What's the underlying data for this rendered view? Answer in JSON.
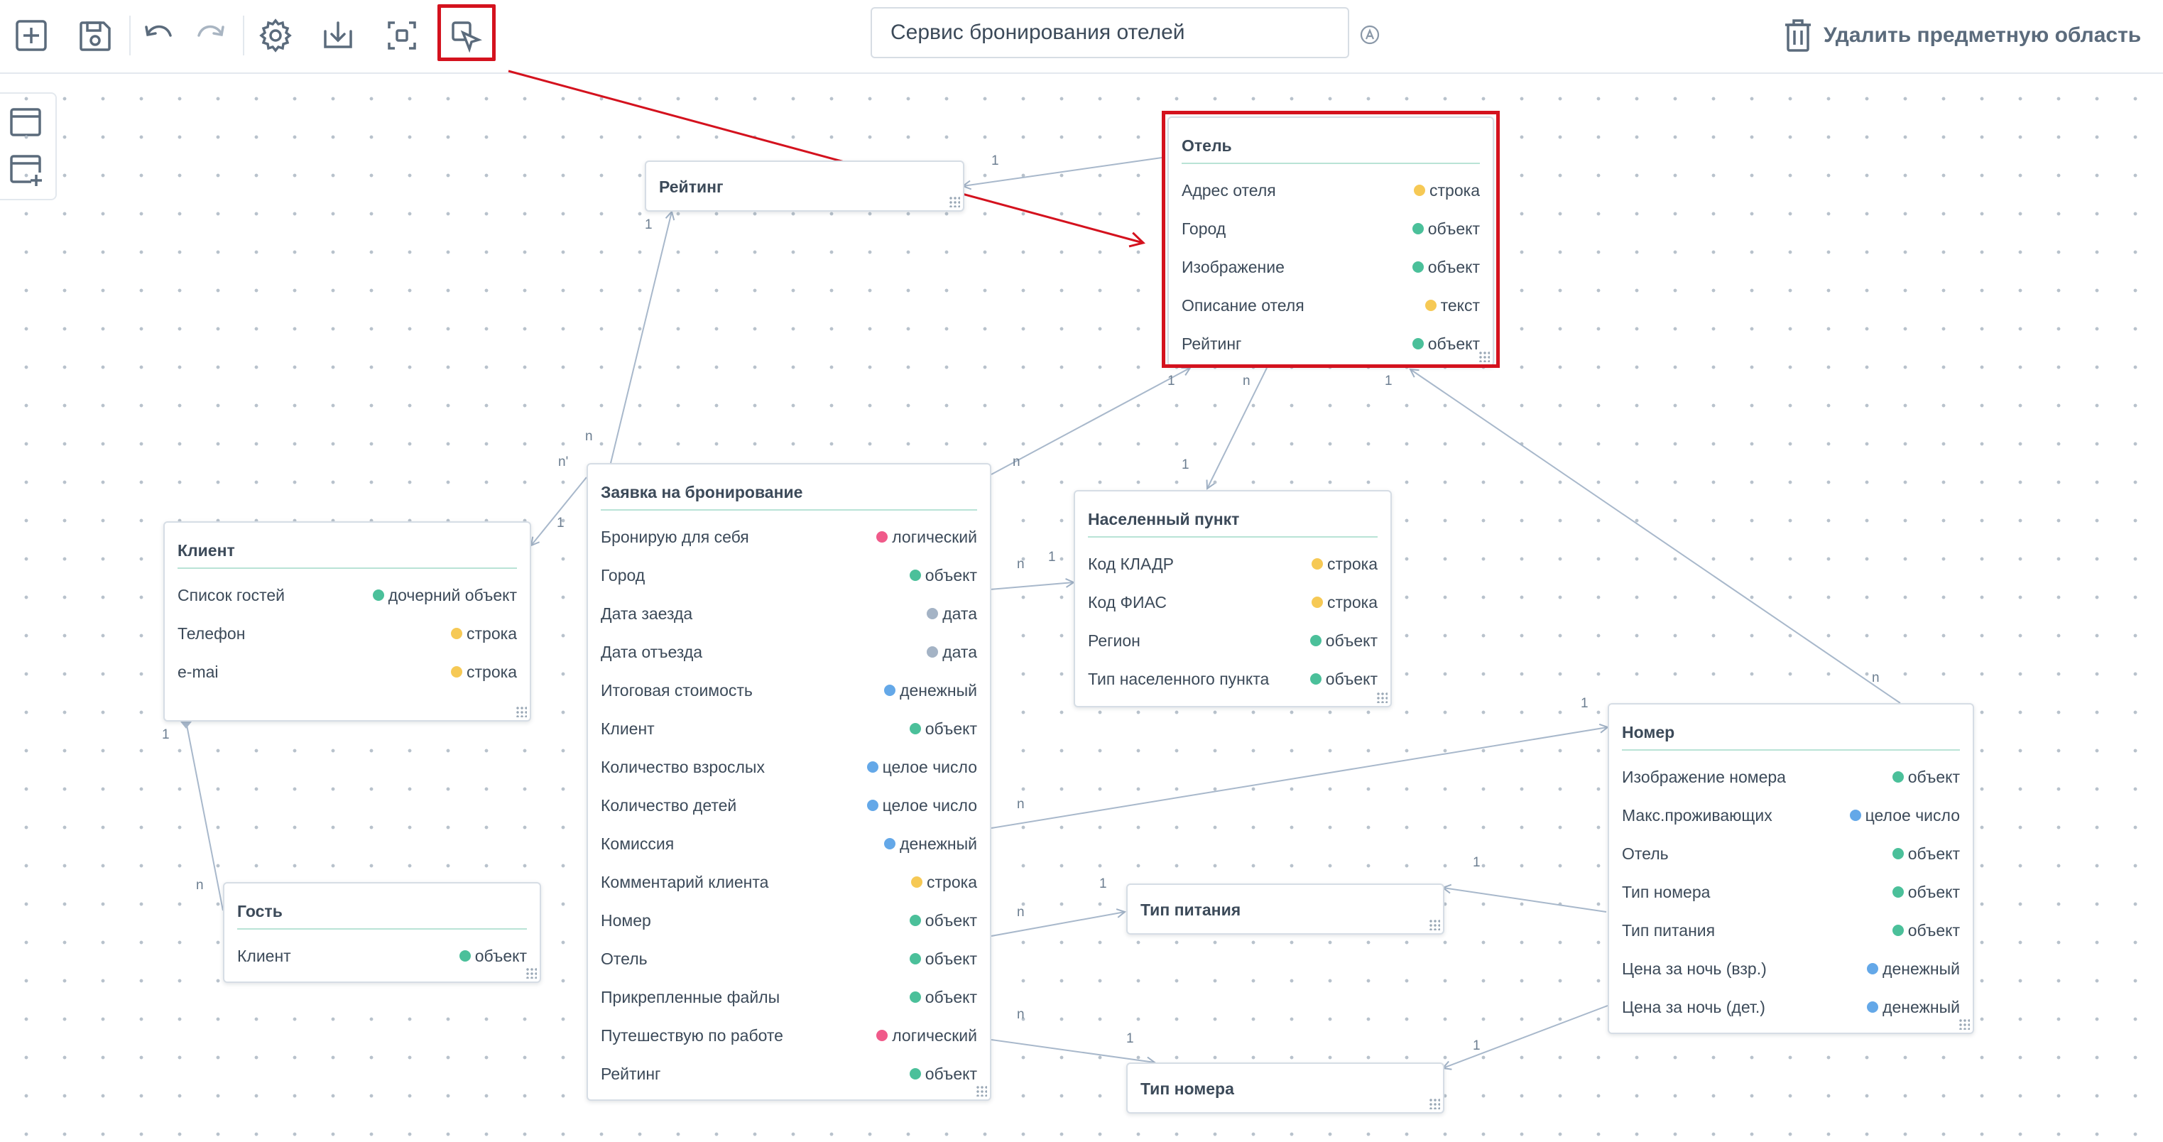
{
  "toolbar": {
    "buttons": [
      {
        "name": "add-button",
        "icon": "plus-square-icon"
      },
      {
        "name": "save-button",
        "icon": "floppy-disk-icon"
      },
      {
        "name": "undo-button",
        "icon": "undo-icon"
      },
      {
        "name": "redo-button",
        "icon": "redo-icon"
      },
      {
        "name": "settings-button",
        "icon": "gear-icon"
      },
      {
        "name": "download-button",
        "icon": "download-icon"
      },
      {
        "name": "focus-button",
        "icon": "focus-icon"
      },
      {
        "name": "edit-mode-button",
        "icon": "cursor-edit-icon"
      }
    ],
    "domain_name": "Сервис бронирования отелей",
    "delete_label": "Удалить предметную область",
    "accent_color": "#d4121e"
  },
  "palette": {
    "items": [
      {
        "name": "add-entity-button",
        "icon": "window-icon"
      },
      {
        "name": "add-child-entity-button",
        "icon": "window-plus-icon"
      }
    ]
  },
  "entities": {
    "hotel": {
      "title": "Отель",
      "attrs": [
        {
          "label": "Адрес отеля",
          "type": "строка",
          "color": "yellow"
        },
        {
          "label": "Город",
          "type": "объект",
          "color": "green"
        },
        {
          "label": "Изображение",
          "type": "объект",
          "color": "green"
        },
        {
          "label": "Описание отеля",
          "type": "текст",
          "color": "yellow"
        },
        {
          "label": "Рейтинг",
          "type": "объект",
          "color": "green"
        }
      ]
    },
    "rating": {
      "title": "Рейтинг",
      "attrs": []
    },
    "booking": {
      "title": "Заявка на бронирование",
      "attrs": [
        {
          "label": "Бронирую для себя",
          "type": "логический",
          "color": "pink"
        },
        {
          "label": "Город",
          "type": "объект",
          "color": "green"
        },
        {
          "label": "Дата заезда",
          "type": "дата",
          "color": "gray"
        },
        {
          "label": "Дата отъезда",
          "type": "дата",
          "color": "gray"
        },
        {
          "label": "Итоговая стоимость",
          "type": "денежный",
          "color": "blue"
        },
        {
          "label": "Клиент",
          "type": "объект",
          "color": "green"
        },
        {
          "label": "Количество взрослых",
          "type": "целое число",
          "color": "blue"
        },
        {
          "label": "Количество детей",
          "type": "целое число",
          "color": "blue"
        },
        {
          "label": "Комиссия",
          "type": "денежный",
          "color": "blue"
        },
        {
          "label": "Комментарий клиента",
          "type": "строка",
          "color": "yellow"
        },
        {
          "label": "Номер",
          "type": "объект",
          "color": "green"
        },
        {
          "label": "Отель",
          "type": "объект",
          "color": "green"
        },
        {
          "label": "Прикрепленные файлы",
          "type": "объект",
          "color": "green"
        },
        {
          "label": "Путешествую по работе",
          "type": "логический",
          "color": "pink"
        },
        {
          "label": "Рейтинг",
          "type": "объект",
          "color": "green"
        }
      ]
    },
    "client": {
      "title": "Клиент",
      "attrs": [
        {
          "label": "Список гостей",
          "type": "дочерний объект",
          "color": "green"
        },
        {
          "label": "Телефон",
          "type": "строка",
          "color": "yellow"
        },
        {
          "label": "e-mai",
          "type": "строка",
          "color": "yellow"
        }
      ]
    },
    "guest": {
      "title": "Гость",
      "attrs": [
        {
          "label": "Клиент",
          "type": "объект",
          "color": "green"
        }
      ]
    },
    "locality": {
      "title": "Населенный пункт",
      "attrs": [
        {
          "label": "Код КЛАДР",
          "type": "строка",
          "color": "yellow"
        },
        {
          "label": "Код ФИАС",
          "type": "строка",
          "color": "yellow"
        },
        {
          "label": "Регион",
          "type": "объект",
          "color": "green"
        },
        {
          "label": "Тип населенного пункта",
          "type": "объект",
          "color": "green"
        }
      ]
    },
    "room": {
      "title": "Номер",
      "attrs": [
        {
          "label": "Изображение номера",
          "type": "объект",
          "color": "green"
        },
        {
          "label": "Макс.проживающих",
          "type": "целое число",
          "color": "blue"
        },
        {
          "label": "Отель",
          "type": "объект",
          "color": "green"
        },
        {
          "label": "Тип номера",
          "type": "объект",
          "color": "green"
        },
        {
          "label": "Тип питания",
          "type": "объект",
          "color": "green"
        },
        {
          "label": "Цена за ночь (взр.)",
          "type": "денежный",
          "color": "blue"
        },
        {
          "label": "Цена за ночь (дет.)",
          "type": "денежный",
          "color": "blue"
        }
      ]
    },
    "meal": {
      "title": "Тип питания",
      "attrs": []
    },
    "roomtype": {
      "title": "Тип номера",
      "attrs": []
    }
  },
  "cardinality": {
    "one": "1",
    "many": "n",
    "many_prime": "n'"
  }
}
